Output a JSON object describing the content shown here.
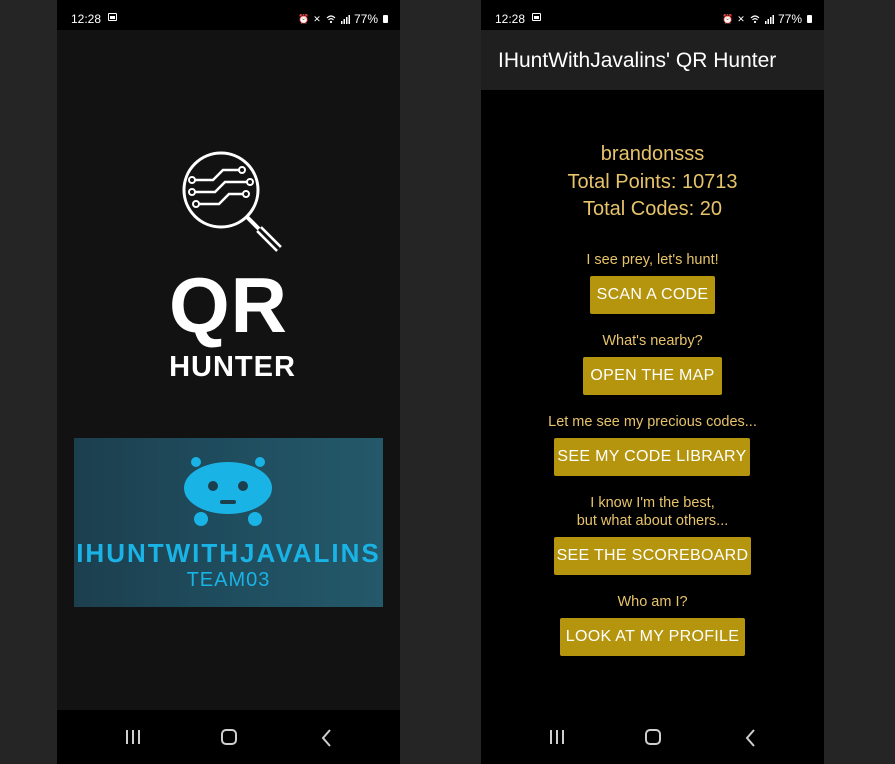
{
  "splash": {
    "status": {
      "time": "12:28",
      "battery": "77%"
    },
    "qr_text": "QR",
    "hunter_text": "HUNTER",
    "team_name": "IHUNTWITHJAVALINS",
    "team_id": "TEAM03"
  },
  "home": {
    "status": {
      "time": "12:28",
      "battery": "77%"
    },
    "title": "IHuntWithJavalins' QR Hunter",
    "username": "brandonsss",
    "total_points": "Total Points: 10713",
    "total_codes": "Total Codes: 20",
    "actions": [
      {
        "prompt": "I see prey, let's hunt!",
        "button": "SCAN A CODE"
      },
      {
        "prompt": "What's nearby?",
        "button": "OPEN THE MAP"
      },
      {
        "prompt": "Let me see my precious codes...",
        "button": "SEE MY CODE LIBRARY"
      },
      {
        "prompt_line1": "I know I'm the best,",
        "prompt_line2": "but what about others...",
        "button": "SEE THE SCOREBOARD"
      },
      {
        "prompt": "Who am I?",
        "button": "LOOK AT MY PROFILE"
      }
    ]
  },
  "icons": [
    "image-icon",
    "alarm-icon",
    "mute-icon",
    "wifi-icon",
    "signal-icon",
    "battery-icon",
    "recent-apps-icon",
    "home-icon",
    "back-icon",
    "magnifier-circuit-icon",
    "robot-mascot-icon"
  ],
  "colors": {
    "accent_button": "#b5950d",
    "accent_text": "#e7c36a",
    "team_blue": "#1ab3e6"
  }
}
